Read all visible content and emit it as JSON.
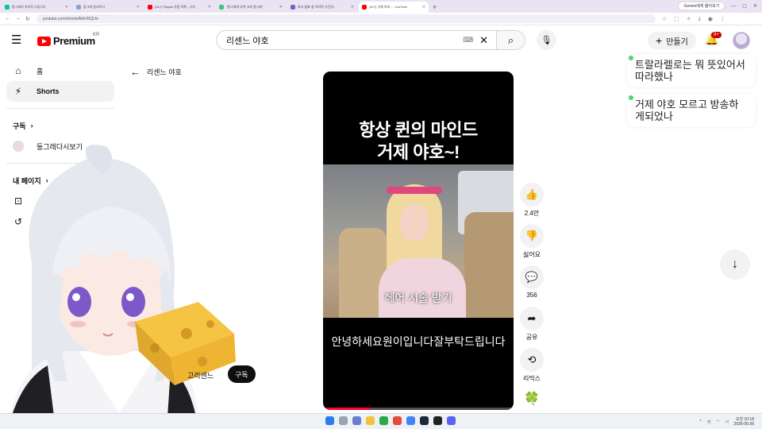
{
  "browser": {
    "tabs": [
      {
        "title": "둥그레의 치지직 스튜디오",
        "color": "#00c896",
        "active": false
      },
      {
        "title": "둥그레 링크트리",
        "color": "#8aa4c8",
        "active": false
      },
      {
        "title": "(417) Playlist 추림 목록 - 나의",
        "color": "#ff0000",
        "active": false
      },
      {
        "title": "\"둥그레의 야겨 크비 둥그레\"",
        "color": "#39c97a",
        "active": false
      },
      {
        "title": "최고 쉽표 총 아지막 거곤의 -",
        "color": "#7a5cc7",
        "active": false
      },
      {
        "title": "(417) 거제 야호~ - YouTube",
        "color": "#ff0000",
        "active": true
      }
    ],
    "new_tab": "+",
    "url": "youtube.com/shorts/AtkVRQLfo",
    "gemini_label": "Gemini에게 물어보기",
    "nav": {
      "back": "←",
      "forward": "→",
      "reload": "↻"
    }
  },
  "header": {
    "logo_text": "Premium",
    "region": "KR",
    "search_query": "리센느 야호",
    "create_label": "만들기",
    "notification_count": "9+"
  },
  "sidebar": {
    "items": [
      {
        "icon": "home-icon",
        "glyph": "⌂",
        "label": "홈",
        "active": false
      },
      {
        "icon": "shorts-icon",
        "glyph": "⚡",
        "label": "Shorts",
        "active": true
      }
    ],
    "subscriptions_label": "구독",
    "subscriptions_chevron": "›",
    "channels": [
      {
        "label": "둥그레다시보기"
      }
    ],
    "mypage_label": "내 페이지",
    "mypage_chevron": "›"
  },
  "page": {
    "back_title": "리센느 야호"
  },
  "short": {
    "headline_line1": "항상 퀸의 마인드",
    "headline_line2": "거제 야호~!",
    "caption_scene": "헤어 시술 받기",
    "caption_sub": "안녕하세요원이입니다잘부탁드립니다",
    "progress": 0.25,
    "channel_name": "고리센느",
    "subscribe_label": "구독"
  },
  "actions": [
    {
      "name": "like-button",
      "icon": "thumbs-up-icon",
      "glyph": "👍",
      "label": "2.4만"
    },
    {
      "name": "dislike-button",
      "icon": "thumbs-down-icon",
      "glyph": "👎",
      "label": "싫어요"
    },
    {
      "name": "comments-button",
      "icon": "comment-icon",
      "glyph": "💬",
      "label": "356"
    },
    {
      "name": "share-button",
      "icon": "share-icon",
      "glyph": "➦",
      "label": "공유"
    },
    {
      "name": "remix-button",
      "icon": "remix-icon",
      "glyph": "⟲",
      "label": "리믹스"
    }
  ],
  "chat": [
    {
      "text": "트랄라렐로는 뭐 뜻있어서 따라했나"
    },
    {
      "text": "거제 야호 모르고 방송하게되었나"
    }
  ],
  "taskbar": {
    "time": "오전 10:18",
    "date": "2026-05-26",
    "lang": "가",
    "tray_caret": "^"
  },
  "colors": {
    "youtube_red": "#ff0000",
    "chat_dot": "#4cd964",
    "clover": "#3ca34a"
  }
}
